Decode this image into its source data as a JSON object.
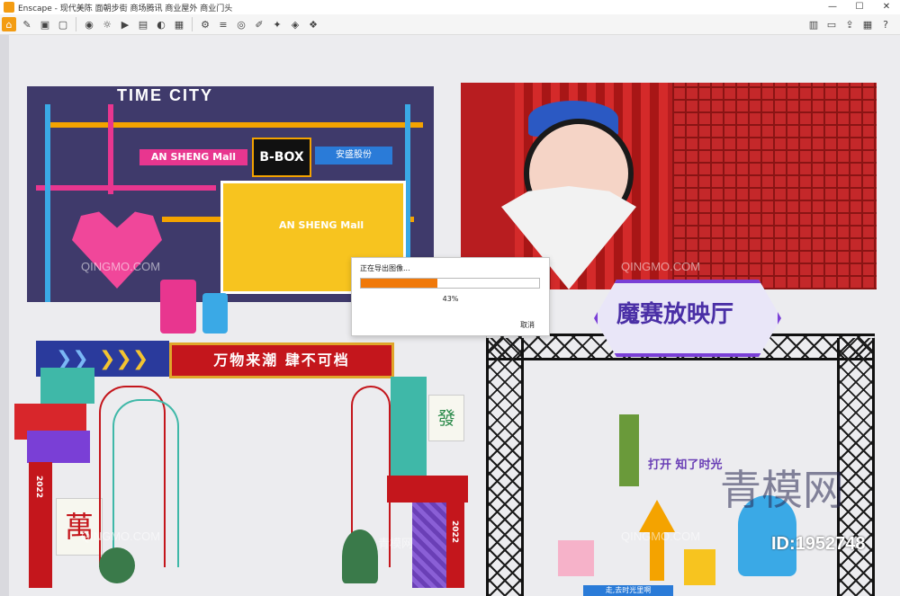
{
  "window": {
    "title": "Enscape - 现代美陈 面朝步街 商场腾讯 商业屋外 商业门头",
    "controls": [
      "—",
      "☐",
      "✕"
    ]
  },
  "toolbar": {
    "left_buttons": [
      "home-icon",
      "brush-icon",
      "cube-icon",
      "box-icon",
      "camera-icon",
      "sun-icon",
      "render-icon",
      "video-icon",
      "panorama-icon",
      "image-icon",
      "settings-icon",
      "layers-icon",
      "eye-icon",
      "pencil-icon",
      "light-icon",
      "material-icon",
      "asset-icon"
    ],
    "right_buttons": [
      "capture-icon",
      "screen-icon",
      "export-icon",
      "layout-icon",
      "help-icon"
    ]
  },
  "scene": {
    "pipes_title": "TIME CITY",
    "mall_sign": "AN SHENG Mall",
    "bbox": "B-BOX",
    "brand_sign": "安盛股份",
    "screen_text": "AN SHENG Mall",
    "banner_text": "万物来潮  肆不可档",
    "tile_wan": "萬",
    "tile_fa": "發",
    "year": "2022",
    "hex_sign": "魔赛放映厅",
    "open_text": "打开 知了时光",
    "bottom_banner": "走,去时光里啊"
  },
  "watermarks": {
    "small": "QINGMO.COM",
    "cn": "青模网",
    "big": "青模网",
    "id": "ID:1952748"
  },
  "dialog": {
    "title": "正在导出图像...",
    "progress_percent_label": "43%",
    "progress_value": 0.43,
    "cancel_label": "取消",
    "fill_color": "#f0790a"
  }
}
